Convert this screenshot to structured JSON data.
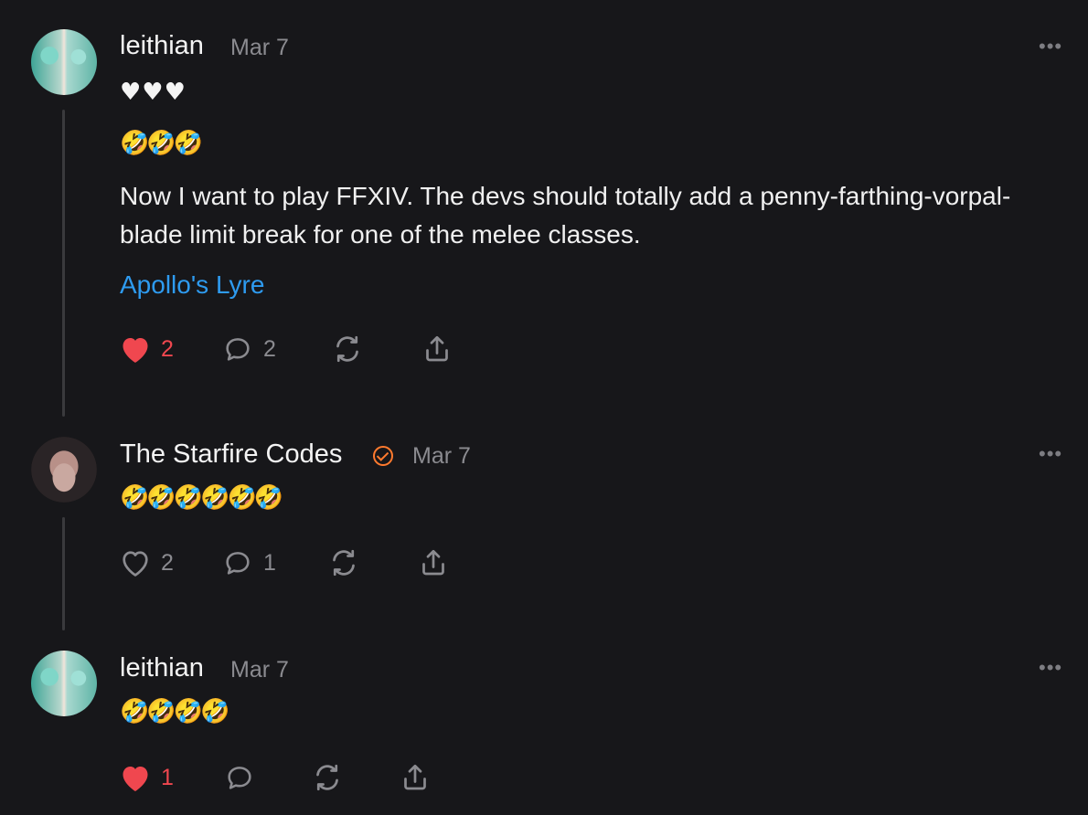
{
  "comments": [
    {
      "author": "leithian",
      "date": "Mar 7",
      "hearts_line": "♥♥♥",
      "emoji_line": "🤣🤣🤣",
      "text": "Now I want to play FFXIV. The devs should totally add a penny-farthing-vorpal-blade limit break for one of the melee classes.",
      "link": "Apollo's Lyre",
      "like_count": "2",
      "reply_count": "2",
      "liked": true
    },
    {
      "author": "The Starfire Codes",
      "date": "Mar 7",
      "emoji_line": "🤣🤣🤣🤣🤣🤣",
      "like_count": "2",
      "reply_count": "1",
      "liked": false,
      "verified": true
    },
    {
      "author": "leithian",
      "date": "Mar 7",
      "emoji_line": "🤣🤣🤣🤣",
      "like_count": "1",
      "liked": true
    }
  ],
  "more_label": "•••",
  "colors": {
    "background": "#17171a",
    "link": "#2e9bf0",
    "liked": "#f0474f",
    "verified": "#ff7a2e"
  }
}
